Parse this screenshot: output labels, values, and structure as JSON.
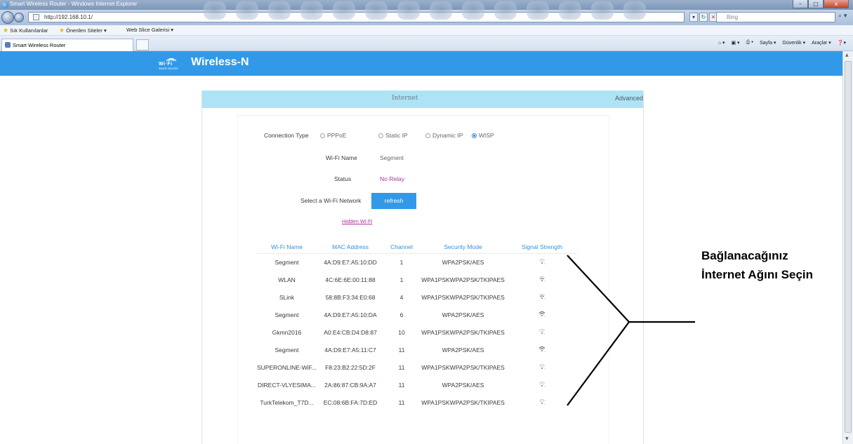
{
  "window": {
    "title": "Smart Wireless Router - Windows Internet Explorer",
    "controls": [
      "–",
      "□",
      "x"
    ]
  },
  "browser": {
    "address": "http://192.168.10.1/",
    "search_placeholder": "Bing",
    "tab_title": "Smart Wireless Router",
    "favorites": {
      "sik_kullanilanlar": "Sık Kullanılanlar",
      "onerilen_siteler": "Önerilen Siteler ▾",
      "web_slice": "Web Slice Galerisi ▾"
    },
    "command_bar": [
      "Sayfa ▾",
      "Güvenlik ▾",
      "Araçlar ▾"
    ]
  },
  "brand": {
    "logo_wifi": "Wi·Fi",
    "logo_sub": "SMART ROUTER",
    "title": "Wireless-N"
  },
  "tabs": {
    "internet": "Internet",
    "advanced": "Advanced"
  },
  "form": {
    "connection_type_label": "Connection Type",
    "connection_options": [
      {
        "label": "PPPoE",
        "selected": false
      },
      {
        "label": "Static IP",
        "selected": false
      },
      {
        "label": "Dynamic IP",
        "selected": false
      },
      {
        "label": "WISP",
        "selected": true
      }
    ],
    "wifi_name_label": "Wi-Fi Name",
    "wifi_name_value": "Segment",
    "status_label": "Status",
    "status_value": "No Relay",
    "select_network_label": "Select a Wi-Fi Network",
    "refresh_label": "refresh",
    "hidden_wifi_link": "Hidden Wi-Fi"
  },
  "network_table": {
    "headers": [
      "Wi-Fi Name",
      "MAC Address",
      "Channel",
      "Security Mode",
      "Signal Strength"
    ],
    "rows": [
      {
        "name": "Segment",
        "mac": "4A:D9:E7:A5:10:DD",
        "channel": "1",
        "security": "WPA2PSK/AES",
        "signal_level": 1
      },
      {
        "name": "WLAN",
        "mac": "4C:6E:6E:00:11:88",
        "channel": "1",
        "security": "WPA1PSKWPA2PSK/TKIPAES",
        "signal_level": 2
      },
      {
        "name": "SLink",
        "mac": "58:8B:F3:34:E0:68",
        "channel": "4",
        "security": "WPA1PSKWPA2PSK/TKIPAES",
        "signal_level": 2
      },
      {
        "name": "Segment",
        "mac": "4A:D9:E7:A5:10:DA",
        "channel": "6",
        "security": "WPA2PSK/AES",
        "signal_level": 3
      },
      {
        "name": "Gkmn2016",
        "mac": "A0:E4:CB:D4:D8:87",
        "channel": "10",
        "security": "WPA1PSKWPA2PSK/TKIPAES",
        "signal_level": 1
      },
      {
        "name": "Segment",
        "mac": "4A:D9:E7:A5:11:C7",
        "channel": "11",
        "security": "WPA2PSK/AES",
        "signal_level": 3
      },
      {
        "name": "SUPERONLINE-WiF...",
        "mac": "F8:23:B2:22:5D:2F",
        "channel": "11",
        "security": "WPA1PSKWPA2PSK/TKIPAES",
        "signal_level": 1
      },
      {
        "name": "DIRECT-VLYESIMA...",
        "mac": "2A:86:87:CB:9A:A7",
        "channel": "11",
        "security": "WPA2PSK/AES",
        "signal_level": 1
      },
      {
        "name": "TurkTelekom_T7D...",
        "mac": "EC:08:6B:FA:7D:ED",
        "channel": "11",
        "security": "WPA1PSKWPA2PSK/TKIPAES",
        "signal_level": 1
      }
    ]
  },
  "annotation": {
    "line1": "Bağlanacağınız",
    "line2": "İnternet Ağını Seçin"
  }
}
